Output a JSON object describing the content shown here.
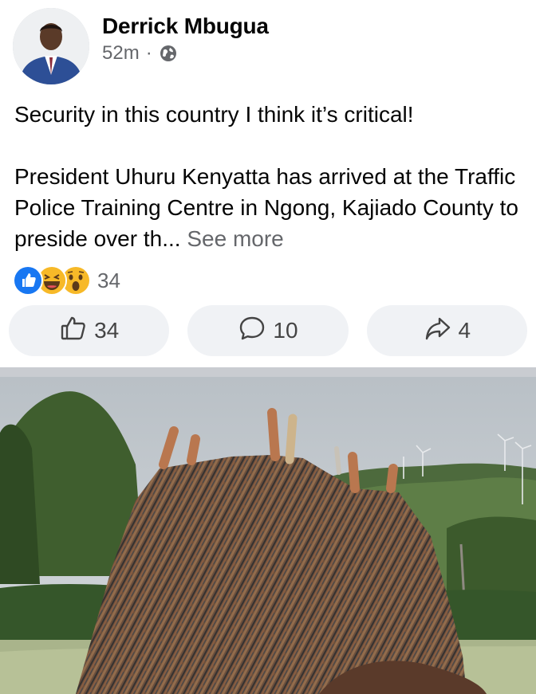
{
  "post": {
    "author": "Derrick Mbugua",
    "time": "52m",
    "separator": "·",
    "visibility_icon": "globe-icon",
    "text_line1": "Security in this country I think it’s critical!",
    "text_para2": "President Uhuru Kenyatta has arrived at the Traffic Police Training Centre in Ngong, Kajiado County to preside over th...",
    "see_more": "See more"
  },
  "reactions": {
    "icons": [
      "like-icon",
      "haha-icon",
      "wow-icon"
    ],
    "count": "34"
  },
  "actions": {
    "like_count": "34",
    "comment_count": "10",
    "share_count": "4"
  },
  "colors": {
    "like_blue": "#1877f2",
    "reaction_yellow": "#f7b928",
    "muted_text": "#65676b",
    "button_bg": "#f0f2f5"
  }
}
